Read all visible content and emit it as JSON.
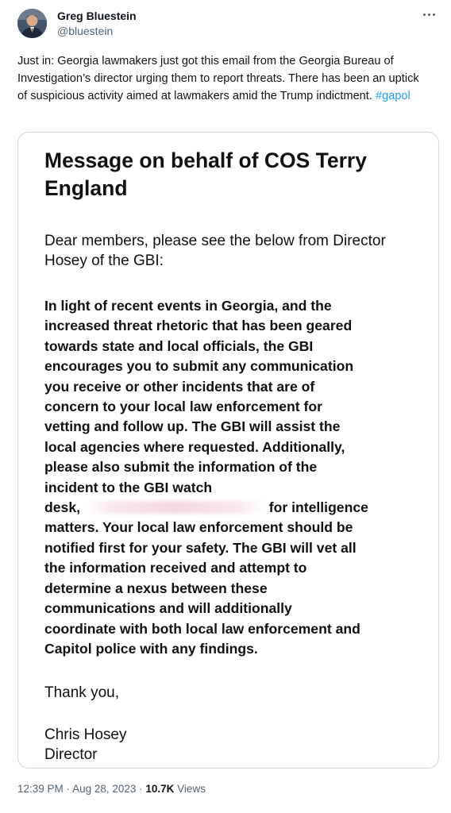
{
  "author": {
    "name": "Greg Bluestein",
    "handle": "@bluestein",
    "avatar_icon": "avatar-photo"
  },
  "header": {
    "more_icon": "more-horizontal-icon"
  },
  "tweet": {
    "text": "Just in: Georgia lawmakers just got this email from the Georgia Bureau of Investigation’s director urging them to report threats. There has been an uptick of suspicious activity aimed at lawmakers amid the Trump indictment.",
    "hashtag": "#gapol"
  },
  "email": {
    "title": "Message on behalf of COS Terry England",
    "greeting": "Dear members, please see the below from Director Hosey of the GBI:",
    "body_lines": [
      "In light of recent events in Georgia, and the",
      "increased threat rhetoric that has been geared",
      "towards state and local officials, the GBI",
      "encourages you to submit any communication",
      "you receive or other incidents that are of",
      "concern to your local law enforcement for",
      "vetting and follow up. The GBI will assist the",
      "local agencies where requested. Additionally,",
      "please also submit the information of the",
      "incident to the GBI watch",
      "desk,",
      "for intelligence",
      "matters. Your local law enforcement should be",
      "notified first for your safety. The GBI will vet all",
      "the information received and attempt to",
      "determine a nexus between these",
      "communications and will additionally",
      "coordinate with both local law enforcement and",
      "Capitol police with any findings."
    ],
    "thanks": "Thank you,",
    "signature_name": "Chris Hosey",
    "signature_title": "Director"
  },
  "meta": {
    "time": "12:39 PM",
    "separator": " · ",
    "date": "Aug 28, 2023",
    "views_count": "10.7K",
    "views_label": " Views"
  },
  "colors": {
    "link": "#1d9bf0",
    "secondary_text": "#536471",
    "border": "#cfd9de"
  }
}
